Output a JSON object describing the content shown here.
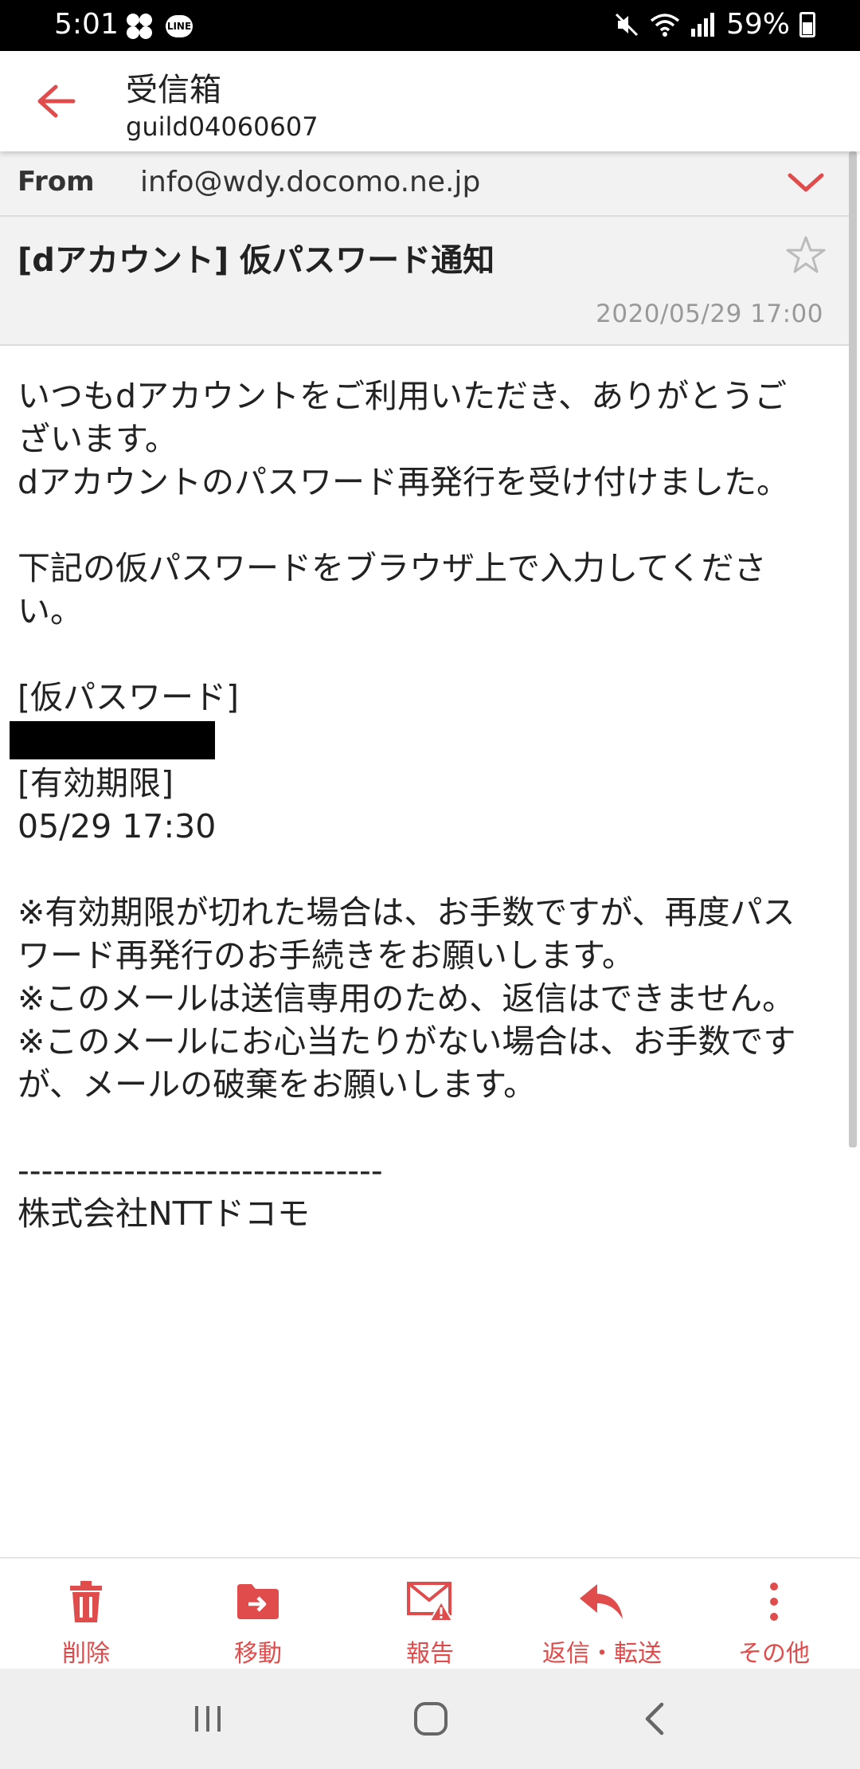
{
  "status_bar": {
    "time": "5:01",
    "line_badge": "LINE",
    "battery": "59%"
  },
  "app_bar": {
    "title": "受信箱",
    "subtitle": "guild04060607"
  },
  "header": {
    "from_label": "From",
    "from_address": "info@wdy.docomo.ne.jp",
    "subject": "[dアカウント] 仮パスワード通知",
    "date": "2020/05/29  17:00"
  },
  "body": {
    "lines": [
      "いつもdアカウントをご利用いただき、ありがとうご",
      "ざいます。",
      "dアカウントのパスワード再発行を受け付けました。",
      "",
      "下記の仮パスワードをブラウザ上で入力してくださ",
      "い。",
      "",
      "[仮パスワード]"
    ],
    "lines_after": [
      "[有効期限]",
      "05/29 17:30",
      "",
      "※有効期限が切れた場合は、お手数ですが、再度パス",
      "ワード再発行のお手続きをお願いします。",
      "※このメールは送信専用のため、返信はできません。",
      "※このメールにお心当たりがない場合は、お手数です",
      "が、メールの破棄をお願いします。",
      "",
      "-------------------------------",
      "株式会社NTTドコモ"
    ]
  },
  "toolbar": {
    "delete": "削除",
    "move": "移動",
    "report": "報告",
    "reply_forward": "返信・転送",
    "other": "その他"
  },
  "colors": {
    "accent": "#e04b4b",
    "header_bg": "#f2f2f2"
  }
}
